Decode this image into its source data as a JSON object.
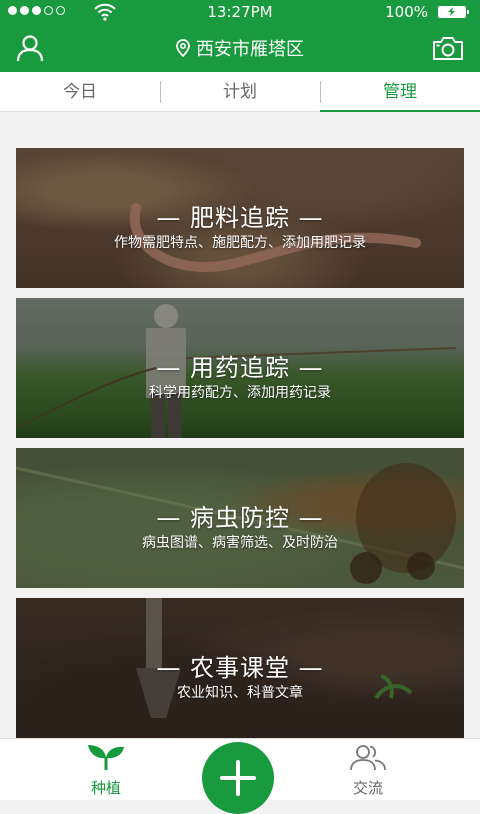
{
  "status_bar": {
    "time": "13:27PM",
    "battery": "100%"
  },
  "header": {
    "location": "西安市雁塔区"
  },
  "tabs": [
    {
      "label": "今日",
      "active": false
    },
    {
      "label": "计划",
      "active": false
    },
    {
      "label": "管理",
      "active": true
    }
  ],
  "cards": [
    {
      "title": "— 肥料追踪 —",
      "subtitle": "作物需肥特点、施肥配方、添加用肥记录"
    },
    {
      "title": "— 用药追踪 —",
      "subtitle": "科学用药配方、添加用药记录"
    },
    {
      "title": "— 病虫防控 —",
      "subtitle": "病虫图谱、病害筛选、及时防治"
    },
    {
      "title": "— 农事课堂 —",
      "subtitle": "农业知识、科普文章"
    }
  ],
  "bottom_nav": {
    "plant_label": "种植",
    "chat_label": "交流"
  },
  "colors": {
    "brand": "#1a9a3e"
  }
}
